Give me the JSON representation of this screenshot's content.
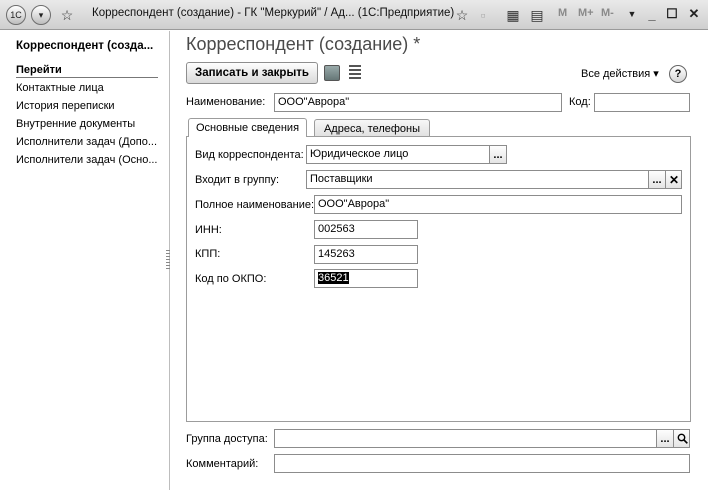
{
  "titlebar": {
    "title": "Корреспондент (создание) - ГК \"Меркурий\" / Ад...   (1С:Предприятие)",
    "logo": "1С",
    "mem_buttons": [
      "M",
      "M+",
      "M-"
    ]
  },
  "sidebar": {
    "title": "Корреспондент (созда...",
    "section": "Перейти",
    "items": [
      {
        "label": "Контактные лица"
      },
      {
        "label": "История переписки"
      },
      {
        "label": "Внутренние документы"
      },
      {
        "label": "Исполнители задач (Допо..."
      },
      {
        "label": "Исполнители задач (Осно..."
      }
    ]
  },
  "form": {
    "title": "Корреспондент (создание) *",
    "save_close_label": "Записать и закрыть",
    "all_actions_label": "Все действия ▾",
    "help_label": "?",
    "name_label": "Наименование:",
    "name_value": "ООО\"Аврора\"",
    "code_label": "Код:",
    "code_value": ""
  },
  "tabs": [
    {
      "label": "Основные сведения",
      "active": true
    },
    {
      "label": "Адреса, телефоны",
      "active": false
    }
  ],
  "main": {
    "type_label": "Вид корреспондента:",
    "type_value": "Юридическое лицо",
    "group_label": "Входит в группу:",
    "group_value": "Поставщики",
    "full_name_label": "Полное наименование:",
    "full_name_value": "ООО\"Аврора\"",
    "inn_label": "ИНН:",
    "inn_value": "002563",
    "kpp_label": "КПП:",
    "kpp_value": "145263",
    "okpo_label": "Код по ОКПО:",
    "okpo_value": "36521"
  },
  "footer": {
    "access_label": "Группа доступа:",
    "access_value": "",
    "comment_label": "Комментарий:",
    "comment_value": ""
  },
  "icons": {
    "ellipsis": "...",
    "clear": "✕",
    "search": "🔍"
  }
}
